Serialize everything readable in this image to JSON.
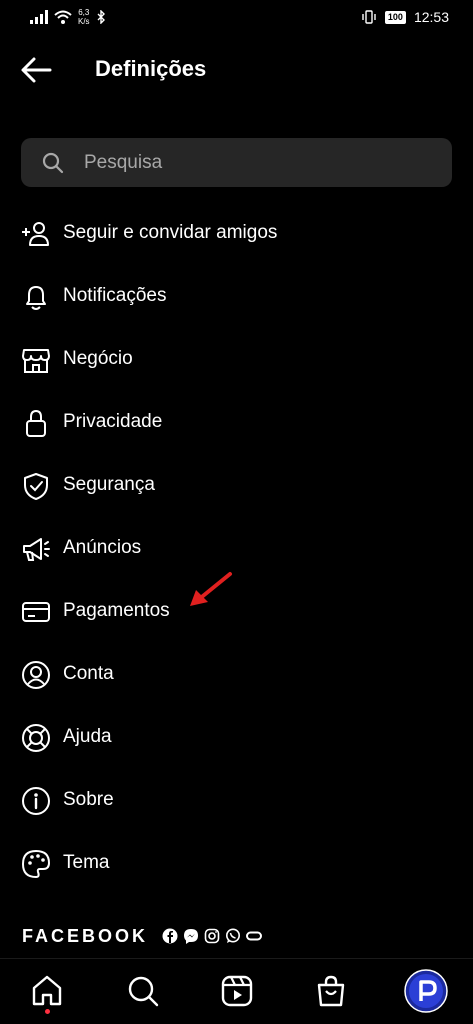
{
  "status_bar": {
    "network_speed_value": "6,3",
    "network_speed_unit": "K/s",
    "battery": "100",
    "time": "12:53"
  },
  "header": {
    "title": "Definições"
  },
  "search": {
    "placeholder": "Pesquisa"
  },
  "menu": {
    "items": [
      {
        "label": "Seguir e convidar amigos",
        "icon": "add-person-icon"
      },
      {
        "label": "Notificações",
        "icon": "bell-icon"
      },
      {
        "label": "Negócio",
        "icon": "shop-icon"
      },
      {
        "label": "Privacidade",
        "icon": "lock-icon"
      },
      {
        "label": "Segurança",
        "icon": "shield-check-icon"
      },
      {
        "label": "Anúncios",
        "icon": "megaphone-icon"
      },
      {
        "label": "Pagamentos",
        "icon": "card-icon"
      },
      {
        "label": "Conta",
        "icon": "account-icon"
      },
      {
        "label": "Ajuda",
        "icon": "lifebuoy-icon"
      },
      {
        "label": "Sobre",
        "icon": "info-icon"
      },
      {
        "label": "Tema",
        "icon": "palette-icon"
      }
    ]
  },
  "footer": {
    "brand": "FACEBOOK"
  },
  "colors": {
    "background": "#000000",
    "search_bg": "#262626",
    "arrow": "#e0201f",
    "notification_dot": "#ff3040",
    "avatar_ring": "#2b3fd6"
  },
  "tabbar": {
    "tabs": [
      "home-icon",
      "search-icon",
      "reels-icon",
      "shop-bag-icon",
      "profile-avatar"
    ]
  }
}
